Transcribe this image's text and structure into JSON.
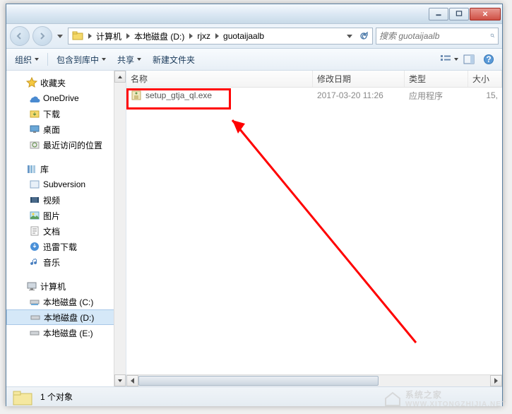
{
  "breadcrumb": {
    "items": [
      "计算机",
      "本地磁盘 (D:)",
      "rjxz",
      "guotaijaalb"
    ]
  },
  "search": {
    "placeholder": "搜索 guotaijaalb"
  },
  "toolbar": {
    "organize": "组织",
    "include": "包含到库中",
    "share": "共享",
    "newfolder": "新建文件夹"
  },
  "sidebar": {
    "favorites": {
      "label": "收藏夹",
      "items": [
        "OneDrive",
        "下载",
        "桌面",
        "最近访问的位置"
      ]
    },
    "libraries": {
      "label": "库",
      "items": [
        "Subversion",
        "视频",
        "图片",
        "文档",
        "迅雷下载",
        "音乐"
      ]
    },
    "computer": {
      "label": "计算机",
      "items": [
        "本地磁盘 (C:)",
        "本地磁盘 (D:)",
        "本地磁盘 (E:)"
      ]
    }
  },
  "columns": {
    "name": "名称",
    "date": "修改日期",
    "type": "类型",
    "size": "大小"
  },
  "files": {
    "rows": [
      {
        "name": "setup_gtja_ql.exe",
        "date": "2017-03-20 11:26",
        "type": "应用程序",
        "size": "15,"
      }
    ]
  },
  "status": {
    "count": "1 个对象"
  },
  "watermark": {
    "brand": "系统之家",
    "url": "WWW.XITONGZHIJIA.NET"
  }
}
